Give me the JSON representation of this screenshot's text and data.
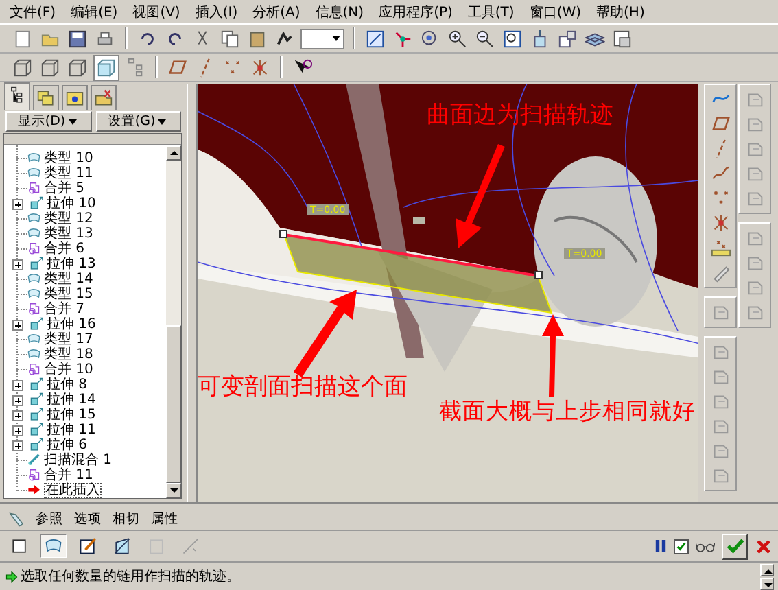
{
  "menu": [
    "文件(F)",
    "编辑(E)",
    "视图(V)",
    "插入(I)",
    "分析(A)",
    "信息(N)",
    "应用程序(P)",
    "工具(T)",
    "窗口(W)",
    "帮助(H)"
  ],
  "model_tree": {
    "tabs": [
      {
        "kind": "tree",
        "selected": true
      },
      {
        "kind": "layers",
        "selected": false
      },
      {
        "kind": "folder",
        "selected": false
      },
      {
        "kind": "favorites",
        "selected": false
      }
    ],
    "buttons": [
      "显示(D)",
      "设置(G)"
    ],
    "items": [
      {
        "kind": "quilt",
        "label": "类型 10",
        "selected": false
      },
      {
        "kind": "quilt",
        "label": "类型 11",
        "selected": false
      },
      {
        "kind": "merge",
        "label": "合并 5",
        "selected": false
      },
      {
        "kind": "extrude",
        "label": "拉伸 10",
        "selected": false
      },
      {
        "kind": "quilt",
        "label": "类型 12",
        "selected": false
      },
      {
        "kind": "quilt",
        "label": "类型 13",
        "selected": false
      },
      {
        "kind": "merge",
        "label": "合并 6",
        "selected": false
      },
      {
        "kind": "extrude",
        "label": "拉伸 13",
        "selected": false
      },
      {
        "kind": "quilt",
        "label": "类型 14",
        "selected": false
      },
      {
        "kind": "quilt",
        "label": "类型 15",
        "selected": false
      },
      {
        "kind": "merge",
        "label": "合并 7",
        "selected": false
      },
      {
        "kind": "extrude",
        "label": "拉伸 16",
        "selected": false
      },
      {
        "kind": "quilt",
        "label": "类型 17",
        "selected": false
      },
      {
        "kind": "quilt",
        "label": "类型 18",
        "selected": false
      },
      {
        "kind": "merge",
        "label": "合并 10",
        "selected": false
      },
      {
        "kind": "extrude",
        "label": "拉伸 8",
        "selected": false
      },
      {
        "kind": "extrude",
        "label": "拉伸 14",
        "selected": false
      },
      {
        "kind": "extrude",
        "label": "拉伸 15",
        "selected": false
      },
      {
        "kind": "extrude",
        "label": "拉伸 11",
        "selected": false
      },
      {
        "kind": "extrude",
        "label": "拉伸 6",
        "selected": false
      },
      {
        "kind": "sweepblend",
        "label": "扫描混合 1",
        "selected": false
      },
      {
        "kind": "merge",
        "label": "合并 11",
        "selected": false
      },
      {
        "kind": "insert",
        "label": "在此插入",
        "selected": true
      }
    ]
  },
  "viewport": {
    "kind": "picture",
    "parameter_labels": [
      "T=0.00",
      "T=0.00"
    ],
    "annotations": [
      "曲面边为扫描轨迹",
      "可变剖面扫描这个面",
      "截面大概与上步相同就好"
    ]
  },
  "dashboard": {
    "tabs": [
      "参照",
      "选项",
      "相切",
      "属性"
    ],
    "tools": [
      {
        "kind": "solid",
        "selected": false
      },
      {
        "kind": "surface",
        "selected": true
      },
      {
        "kind": "sketch",
        "selected": false
      },
      {
        "kind": "remove",
        "selected": false
      },
      {
        "kind": "thicken",
        "selected": false
      },
      {
        "kind": "section",
        "selected": false
      }
    ],
    "preview": {
      "checked": true
    }
  },
  "status": "选取任何数量的链用作扫描的轨迹。"
}
